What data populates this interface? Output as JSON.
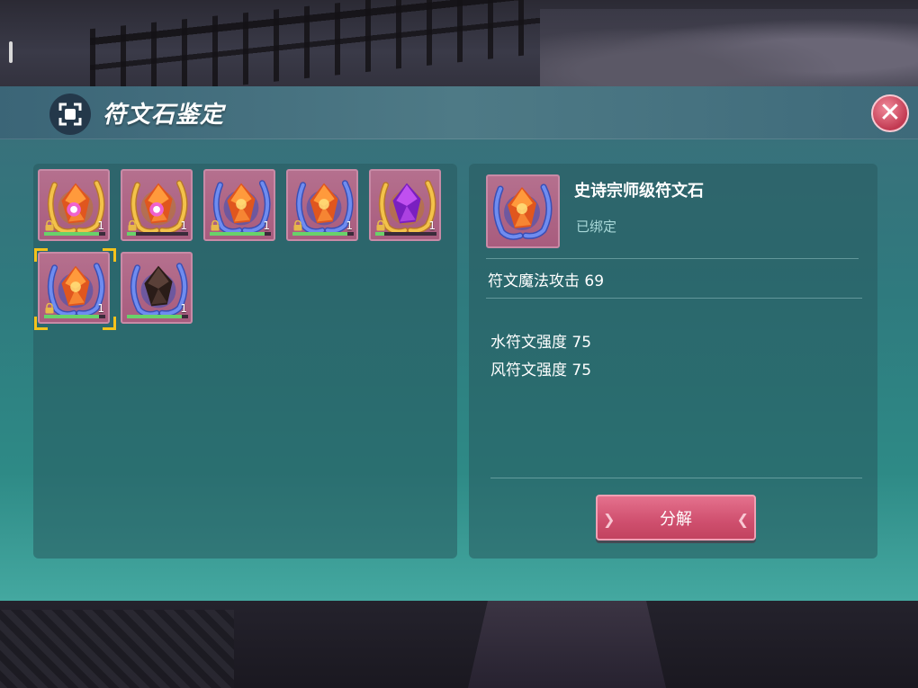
{
  "window": {
    "title": "符文石鉴定",
    "close_symbol": "✕"
  },
  "inventory": {
    "slots": [
      {
        "frame": "gold",
        "gem": "orange",
        "emblem": "eye",
        "count": "1",
        "locked": true,
        "progress": 0.9
      },
      {
        "frame": "gold",
        "gem": "orange",
        "emblem": "eye",
        "count": "1",
        "locked": true,
        "progress": 0.15
      },
      {
        "frame": "blue",
        "gem": "orange",
        "emblem": "sun",
        "count": "1",
        "locked": true,
        "progress": 0.9
      },
      {
        "frame": "blue",
        "gem": "orange",
        "emblem": "sun",
        "count": "1",
        "locked": true,
        "progress": 0.9
      },
      {
        "frame": "gold",
        "gem": "purple",
        "emblem": "none",
        "count": "1",
        "locked": true,
        "progress": 0.15
      },
      {
        "frame": "blue",
        "gem": "orange",
        "emblem": "sun",
        "count": "1",
        "locked": true,
        "progress": 0.9,
        "selected": true
      },
      {
        "frame": "blue",
        "gem": "dark",
        "emblem": "none",
        "count": "1",
        "locked": false,
        "progress": 0.9
      }
    ]
  },
  "detail": {
    "name": "史诗宗师级符文石",
    "bound_status": "已绑定",
    "main_stat": "符文魔法攻击 69",
    "sub_stats": [
      "水符文强度 75",
      "风符文强度 75"
    ],
    "decompose_label": "分解"
  },
  "colors": {
    "panel": "#2f7a7e",
    "slot_bg": "#b5708e",
    "selected_border": "#f4c21b",
    "progress_fill": "#69d26a",
    "button": "#cf4f6e"
  },
  "icons": {
    "title": "scan-frame-icon",
    "close": "close-icon",
    "lock": "lock-icon"
  }
}
